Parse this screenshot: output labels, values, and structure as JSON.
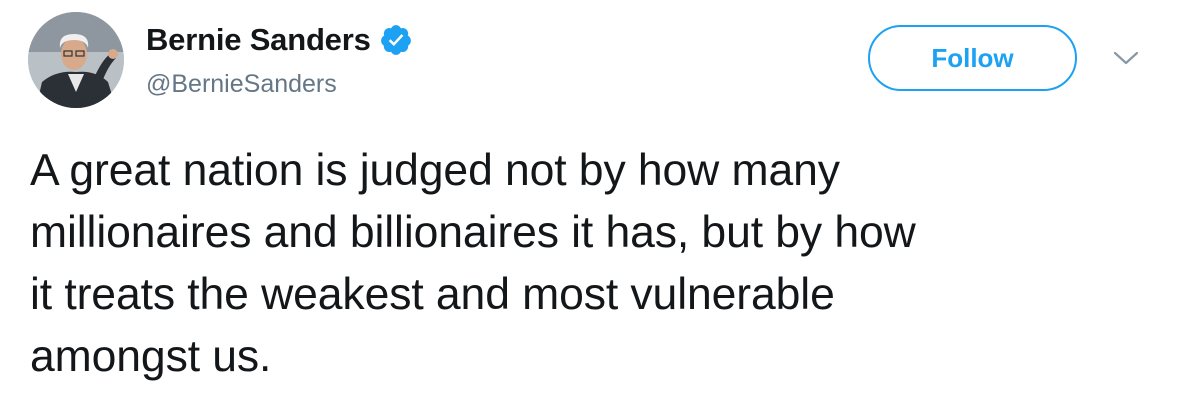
{
  "author": {
    "display_name": "Bernie Sanders",
    "handle": "@BernieSanders",
    "verified": true,
    "avatar_icon": "user-avatar-photo"
  },
  "actions": {
    "follow_label": "Follow",
    "menu_icon": "chevron-down-icon"
  },
  "tweet": {
    "lines": [
      "A great nation is judged not by how many",
      "millionaires and billionaires it has, but by how",
      "it treats the weakest and most vulnerable",
      "amongst us."
    ]
  },
  "colors": {
    "accent": "#1da1f2",
    "text": "#14171a",
    "secondary_text": "#657786"
  }
}
